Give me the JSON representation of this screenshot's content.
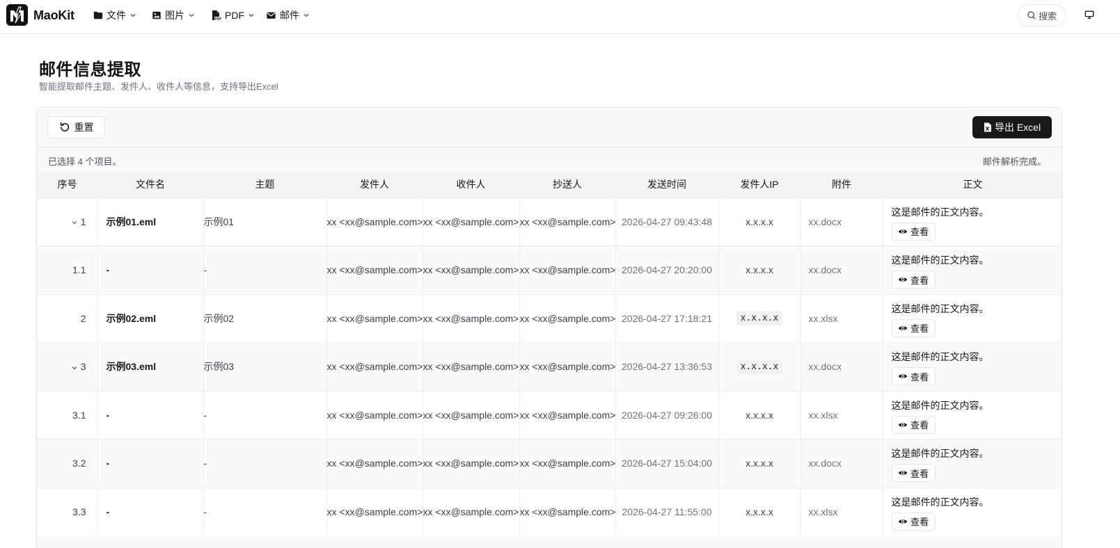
{
  "header": {
    "logo_text": "MaoKit",
    "nav": [
      {
        "label": "文件",
        "icon": "folder-icon"
      },
      {
        "label": "图片",
        "icon": "image-icon"
      },
      {
        "label": "PDF",
        "icon": "pdf-file-icon"
      },
      {
        "label": "邮件",
        "icon": "mail-icon"
      }
    ],
    "search_label": "搜索"
  },
  "page": {
    "title": "邮件信息提取",
    "subtitle": "智能提取邮件主题、发件人、收件人等信息，支持导出Excel"
  },
  "toolbar": {
    "reset_label": "重置",
    "export_label": "导出 Excel"
  },
  "status": {
    "selected": "已选择 4 个项目。",
    "parse_done": "邮件解析完成。"
  },
  "table": {
    "columns": [
      "序号",
      "文件名",
      "主题",
      "发件人",
      "收件人",
      "抄送人",
      "发送时间",
      "发件人IP",
      "附件",
      "正文"
    ],
    "view_label": "查看",
    "rows": [
      {
        "idx": "1",
        "expand": true,
        "file": "示例01.eml",
        "subject": "示例01",
        "from": "xx <xx@sample.com>",
        "to": "xx <xx@sample.com>",
        "cc": "xx <xx@sample.com>",
        "time": "2026-04-27 09:43:48",
        "ip": "x.x.x.x",
        "ip_badge": false,
        "attachment": "xx.docx",
        "body": "这是邮件的正文内容。"
      },
      {
        "idx": "1.1",
        "expand": false,
        "file": "-",
        "subject": "-",
        "from": "xx <xx@sample.com>",
        "to": "xx <xx@sample.com>",
        "cc": "xx <xx@sample.com>",
        "time": "2026-04-27 20:20:00",
        "ip": "x.x.x.x",
        "ip_badge": false,
        "attachment": "xx.docx",
        "body": "这是邮件的正文内容。"
      },
      {
        "idx": "2",
        "expand": false,
        "file": "示例02.eml",
        "subject": "示例02",
        "from": "xx <xx@sample.com>",
        "to": "xx <xx@sample.com>",
        "cc": "xx <xx@sample.com>",
        "time": "2026-04-27 17:18:21",
        "ip": "x.x.x.x",
        "ip_badge": true,
        "attachment": "xx.xlsx",
        "body": "这是邮件的正文内容。"
      },
      {
        "idx": "3",
        "expand": true,
        "file": "示例03.eml",
        "subject": "示例03",
        "from": "xx <xx@sample.com>",
        "to": "xx <xx@sample.com>",
        "cc": "xx <xx@sample.com>",
        "time": "2026-04-27 13:36:53",
        "ip": "x.x.x.x",
        "ip_badge": true,
        "attachment": "xx.docx",
        "body": "这是邮件的正文内容。"
      },
      {
        "idx": "3.1",
        "expand": false,
        "file": "-",
        "subject": "-",
        "from": "xx <xx@sample.com>",
        "to": "xx <xx@sample.com>",
        "cc": "xx <xx@sample.com>",
        "time": "2026-04-27 09:26:00",
        "ip": "x.x.x.x",
        "ip_badge": false,
        "attachment": "xx.xlsx",
        "body": "这是邮件的正文内容。"
      },
      {
        "idx": "3.2",
        "expand": false,
        "file": "-",
        "subject": "-",
        "from": "xx <xx@sample.com>",
        "to": "xx <xx@sample.com>",
        "cc": "xx <xx@sample.com>",
        "time": "2026-04-27 15:04:00",
        "ip": "x.x.x.x",
        "ip_badge": false,
        "attachment": "xx.docx",
        "body": "这是邮件的正文内容。"
      },
      {
        "idx": "3.3",
        "expand": false,
        "file": "-",
        "subject": "-",
        "from": "xx <xx@sample.com>",
        "to": "xx <xx@sample.com>",
        "cc": "xx <xx@sample.com>",
        "time": "2026-04-27 11:55:00",
        "ip": "x.x.x.x",
        "ip_badge": false,
        "attachment": "xx.xlsx",
        "body": "这是邮件的正文内容。"
      }
    ]
  }
}
